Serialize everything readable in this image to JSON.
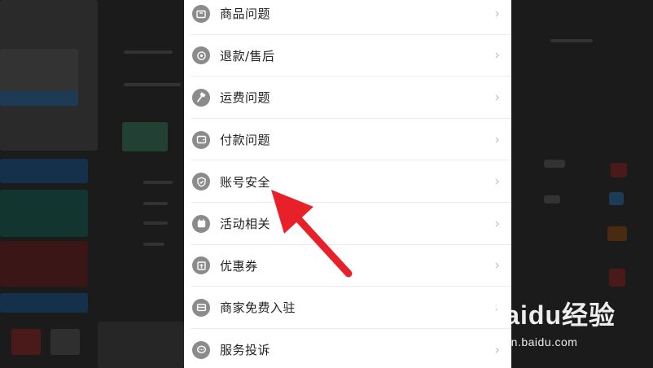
{
  "menu": {
    "items": [
      {
        "label": "商品问题",
        "icon": "box-icon"
      },
      {
        "label": "退款/售后",
        "icon": "refund-icon"
      },
      {
        "label": "运费问题",
        "icon": "hammer-icon"
      },
      {
        "label": "付款问题",
        "icon": "wallet-icon"
      },
      {
        "label": "账号安全",
        "icon": "shield-icon"
      },
      {
        "label": "活动相关",
        "icon": "calendar-icon"
      },
      {
        "label": "优惠券",
        "icon": "coupon-icon"
      },
      {
        "label": "商家免费入驻",
        "icon": "store-icon"
      },
      {
        "label": "服务投诉",
        "icon": "chat-icon"
      }
    ],
    "chevron": "›"
  },
  "watermark": {
    "brand": "Baidu经验",
    "url": "jingyan.baidu.com"
  },
  "colors": {
    "arrow": "#e8202a",
    "icon_gray": "#8b8b8b",
    "panel_bg": "#ffffff"
  }
}
